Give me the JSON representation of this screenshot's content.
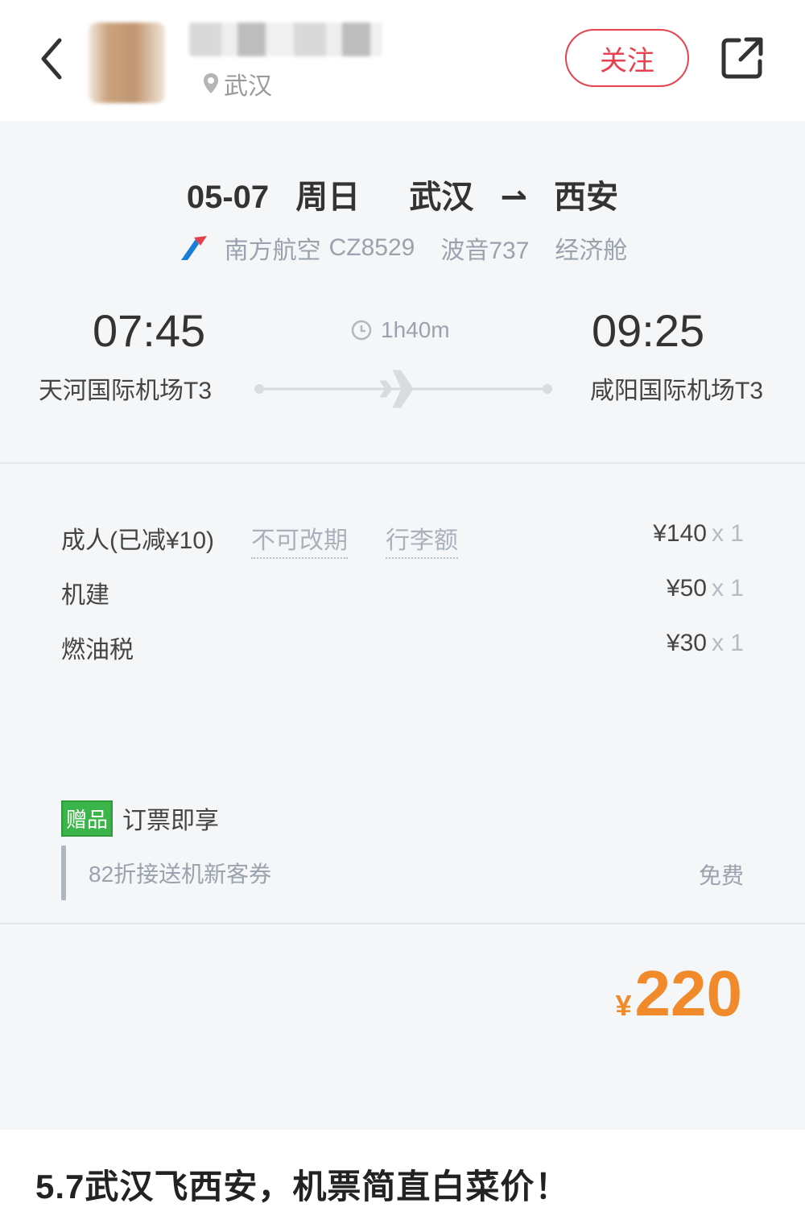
{
  "header": {
    "location": "武汉",
    "follow_label": "关注"
  },
  "flight": {
    "date": "05-07",
    "weekday": "周日",
    "from_city": "武汉",
    "to_city": "西安",
    "airline": "南方航空",
    "flight_no": "CZ8529",
    "aircraft": "波音737",
    "cabin": "经济舱",
    "dep_time": "07:45",
    "arr_time": "09:25",
    "duration": "1h40m",
    "dep_airport": "天河国际机场T3",
    "arr_airport": "咸阳国际机场T3"
  },
  "prices": {
    "adult_label": "成人(已减¥10)",
    "no_change_tag": "不可改期",
    "baggage_tag": "行李额",
    "adult_amount": "¥140",
    "adult_qty": "x 1",
    "airport_fee_label": "机建",
    "airport_fee_amount": "¥50",
    "airport_fee_qty": "x 1",
    "fuel_label": "燃油税",
    "fuel_amount": "¥30",
    "fuel_qty": "x 1"
  },
  "gift": {
    "badge": "赠品",
    "title": "订票即享",
    "coupon": "82折接送机新客券",
    "coupon_price": "免费"
  },
  "total": {
    "currency": "¥",
    "amount": "220"
  },
  "post": {
    "caption": "5.7武汉飞西安，机票简直白菜价！"
  },
  "colors": {
    "follow_red": "#e8414f",
    "price_orange": "#f08a2a",
    "gift_green": "#3bb54a",
    "card_bg": "#f4f6f8"
  },
  "icons": [
    "back-icon",
    "location-pin-icon",
    "share-icon",
    "airline-logo-icon",
    "clock-icon",
    "plane-icon"
  ]
}
